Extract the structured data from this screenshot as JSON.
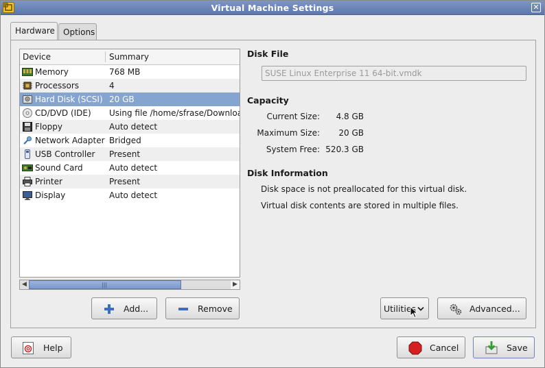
{
  "window": {
    "title": "Virtual Machine Settings",
    "close_glyph": "✕"
  },
  "tabs": [
    {
      "label": "Hardware"
    },
    {
      "label": "Options"
    }
  ],
  "device_list": {
    "columns": {
      "device": "Device",
      "summary": "Summary"
    },
    "rows": [
      {
        "name": "Memory",
        "summary": "768 MB",
        "icon": "memory-icon"
      },
      {
        "name": "Processors",
        "summary": "4",
        "icon": "processor-icon"
      },
      {
        "name": "Hard Disk (SCSI)",
        "summary": "20 GB",
        "icon": "hard-disk-icon"
      },
      {
        "name": "CD/DVD (IDE)",
        "summary": "Using file /home/sfrase/Downloa",
        "icon": "cd-dvd-icon"
      },
      {
        "name": "Floppy",
        "summary": "Auto detect",
        "icon": "floppy-icon"
      },
      {
        "name": "Network Adapter",
        "summary": "Bridged",
        "icon": "network-icon"
      },
      {
        "name": "USB Controller",
        "summary": "Present",
        "icon": "usb-icon"
      },
      {
        "name": "Sound Card",
        "summary": "Auto detect",
        "icon": "sound-card-icon"
      },
      {
        "name": "Printer",
        "summary": "Present",
        "icon": "printer-icon"
      },
      {
        "name": "Display",
        "summary": "Auto detect",
        "icon": "display-icon"
      }
    ],
    "selected_index": 2
  },
  "buttons": {
    "add": "Add...",
    "remove": "Remove",
    "utilities": "Utilities",
    "advanced": "Advanced...",
    "help": "Help",
    "cancel": "Cancel",
    "save": "Save"
  },
  "disk_file": {
    "title": "Disk File",
    "value": "SUSE Linux Enterprise 11 64-bit.vmdk"
  },
  "capacity": {
    "title": "Capacity",
    "current_label": "Current Size:",
    "current_value": "4.8 GB",
    "max_label": "Maximum Size:",
    "max_value": "20 GB",
    "free_label": "System Free:",
    "free_value": "520.3 GB"
  },
  "disk_info": {
    "title": "Disk Information",
    "line1": "Disk space is not preallocated for this virtual disk.",
    "line2": "Virtual disk contents are stored in multiple files."
  },
  "colors": {
    "selection": "#86a4d0",
    "titlebar": "#6b84b8",
    "cancel_icon": "#d42020",
    "save_icon": "#3a9a3a"
  }
}
